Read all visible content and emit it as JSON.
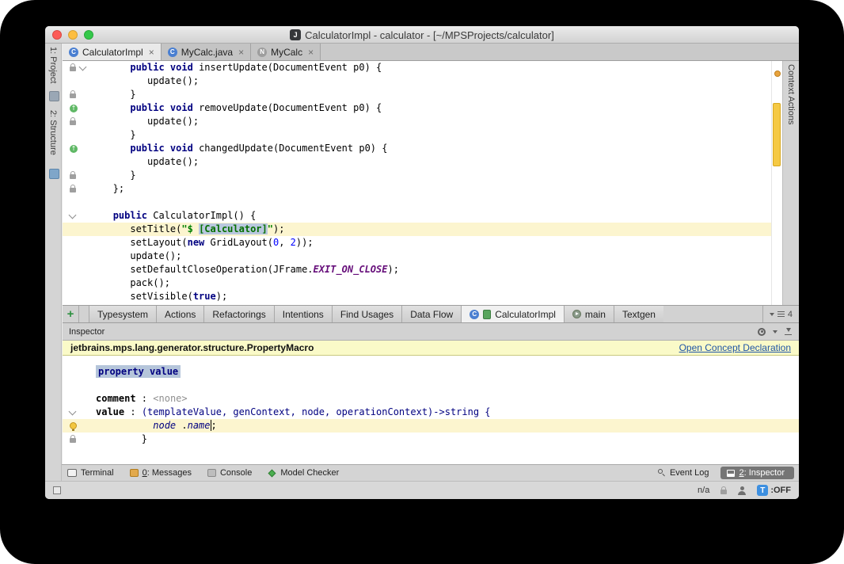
{
  "window": {
    "title": "CalculatorImpl - calculator - [~/MPSProjects/calculator]",
    "app_icon_letter": "J"
  },
  "editor_tabs": [
    {
      "label": "CalculatorImpl",
      "icon_letter": "C",
      "icon_color": "#4a7fd1",
      "close": "×",
      "active": true
    },
    {
      "label": "MyCalc.java",
      "icon_letter": "C",
      "icon_color": "#4a7fd1",
      "close": "×",
      "active": false
    },
    {
      "label": "MyCalc",
      "icon_letter": "N",
      "icon_color": "#9e9e9e",
      "close": "×",
      "active": false
    }
  ],
  "left_strip": [
    {
      "label": "1: Project"
    },
    {
      "label": "2: Structure"
    }
  ],
  "right_strip": {
    "label": "Context Actions"
  },
  "editor": {
    "lines": [
      {
        "g": [
          "lock",
          "fold"
        ],
        "seg": [
          [
            "p",
            "      "
          ],
          [
            "k",
            "public void"
          ],
          [
            "p",
            " insertUpdate(DocumentEvent p0) {"
          ]
        ]
      },
      {
        "g": [],
        "seg": [
          [
            "p",
            "         update();"
          ]
        ]
      },
      {
        "g": [
          "lock"
        ],
        "seg": [
          [
            "p",
            "      }"
          ]
        ]
      },
      {
        "g": [
          "override"
        ],
        "seg": [
          [
            "p",
            "      "
          ],
          [
            "k",
            "public void"
          ],
          [
            "p",
            " removeUpdate(DocumentEvent p0) {"
          ]
        ]
      },
      {
        "g": [
          "lock"
        ],
        "seg": [
          [
            "p",
            "         update();"
          ]
        ]
      },
      {
        "g": [],
        "seg": [
          [
            "p",
            "      }"
          ]
        ]
      },
      {
        "g": [
          "override"
        ],
        "seg": [
          [
            "p",
            "      "
          ],
          [
            "k",
            "public void"
          ],
          [
            "p",
            " changedUpdate(DocumentEvent p0) {"
          ]
        ]
      },
      {
        "g": [],
        "seg": [
          [
            "p",
            "         update();"
          ]
        ]
      },
      {
        "g": [
          "lock"
        ],
        "seg": [
          [
            "p",
            "      }"
          ]
        ]
      },
      {
        "g": [
          "lock"
        ],
        "seg": [
          [
            "p",
            "   };"
          ]
        ]
      },
      {
        "g": [],
        "seg": []
      },
      {
        "g": [
          "fold"
        ],
        "seg": [
          [
            "p",
            "   "
          ],
          [
            "k",
            "public"
          ],
          [
            "p",
            " CalculatorImpl() {"
          ]
        ]
      },
      {
        "g": [],
        "h": true,
        "seg": [
          [
            "p",
            "      setTitle("
          ],
          [
            "str",
            "\"$"
          ],
          [
            "p",
            " "
          ],
          [
            "macro",
            "[Calculator]"
          ],
          [
            "str",
            "\""
          ],
          [
            "p",
            ");"
          ]
        ]
      },
      {
        "g": [],
        "seg": [
          [
            "p",
            "      setLayout("
          ],
          [
            "k",
            "new"
          ],
          [
            "p",
            " GridLayout("
          ],
          [
            "num",
            "0"
          ],
          [
            "p",
            ", "
          ],
          [
            "num",
            "2"
          ],
          [
            "p",
            "));"
          ]
        ]
      },
      {
        "g": [],
        "seg": [
          [
            "p",
            "      update();"
          ]
        ]
      },
      {
        "g": [],
        "seg": [
          [
            "p",
            "      setDefaultCloseOperation(JFrame."
          ],
          [
            "static",
            "EXIT_ON_CLOSE"
          ],
          [
            "p",
            ");"
          ]
        ]
      },
      {
        "g": [],
        "seg": [
          [
            "p",
            "      pack();"
          ]
        ]
      },
      {
        "g": [],
        "seg": [
          [
            "p",
            "      setVisible("
          ],
          [
            "k",
            "true"
          ],
          [
            "p",
            ");"
          ]
        ]
      }
    ]
  },
  "bottom_bar": {
    "add_icon": "+",
    "tabs": [
      "Typesystem",
      "Actions",
      "Refactorings",
      "Intentions",
      "Find Usages",
      "Data Flow"
    ],
    "active_tab": {
      "label": "CalculatorImpl",
      "icon_letter": "C",
      "icon_color": "#4a7fd1"
    },
    "right_tabs": [
      "main",
      "Textgen"
    ],
    "hidden_count": "4"
  },
  "inspector": {
    "panel_title": "Inspector",
    "banner_text": "jetbrains.mps.lang.generator.structure.PropertyMacro",
    "banner_link": "Open Concept Declaration",
    "lines": [
      {
        "g": [],
        "seg": [
          [
            "propsel",
            "property value"
          ]
        ]
      },
      {
        "g": [],
        "seg": []
      },
      {
        "g": [],
        "seg": [
          [
            "b",
            "comment"
          ],
          [
            "p",
            " : "
          ],
          [
            "gray",
            "<none>"
          ]
        ]
      },
      {
        "g": [
          "fold"
        ],
        "seg": [
          [
            "b",
            "value"
          ],
          [
            "p",
            " : "
          ],
          [
            "navy",
            "(templateValue, genContext, node, operationContext)->string {"
          ]
        ]
      },
      {
        "g": [
          "bulb"
        ],
        "h": true,
        "seg": [
          [
            "p",
            "          "
          ],
          [
            "nit",
            "node"
          ],
          [
            "p",
            " ."
          ],
          [
            "nitc",
            "name"
          ],
          [
            "p",
            ";"
          ]
        ]
      },
      {
        "g": [
          "lock"
        ],
        "seg": [
          [
            "p",
            "        }"
          ]
        ]
      }
    ]
  },
  "toolbar": {
    "left": [
      {
        "label": "Terminal",
        "icon": "terminal-icon"
      },
      {
        "label": "0: Messages",
        "icon": "messages-icon",
        "u": true
      },
      {
        "label": "Console",
        "icon": "console-icon"
      },
      {
        "label": "Model Checker",
        "icon": "model-checker-icon"
      }
    ],
    "event_log_label": "Event Log",
    "inspector_chip_label": "2: Inspector"
  },
  "statusbar": {
    "memory": "n/a",
    "toggle_letter": "T",
    "toggle_label": ":OFF"
  }
}
